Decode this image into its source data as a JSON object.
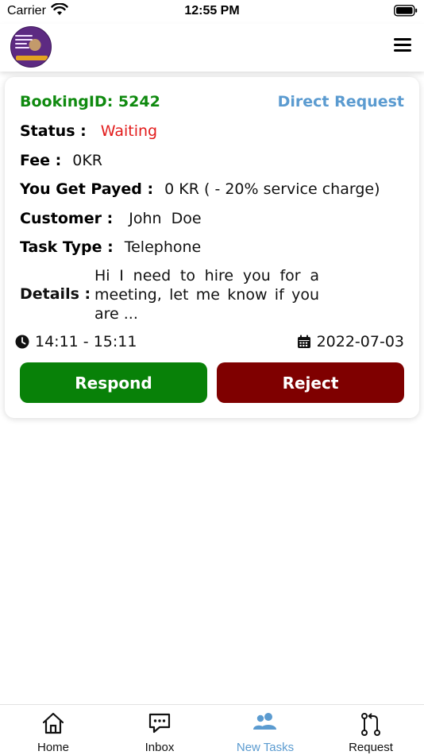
{
  "status_bar": {
    "carrier": "Carrier",
    "time": "12:55 PM"
  },
  "header": {
    "avatar": "profile-avatar",
    "menu_icon": "hamburger-menu-icon"
  },
  "booking": {
    "booking_id_label": "BookingID: 5242",
    "request_type": "Direct Request",
    "status_label": "Status :",
    "status_value": "Waiting",
    "fee_label": "Fee :",
    "fee_value": "0KR",
    "payout_label": "You Get Payed :",
    "payout_value": "0 KR ( - 20% service charge)",
    "customer_label": "Customer :",
    "customer_value": "John  Doe",
    "task_type_label": "Task Type :",
    "task_type_value": "Telephone",
    "details_label": "Details :",
    "details_value": "Hi I need to hire you for a meeting, let me know if you are ...",
    "time_range": "14:11 - 15:11",
    "date": "2022-07-03",
    "respond_label": "Respond",
    "reject_label": "Reject"
  },
  "colors": {
    "booking_id": "#0f8a0f",
    "direct_request": "#5b9bd0",
    "status_waiting": "#e21b1b",
    "respond_button": "#088108",
    "reject_button": "#7f0000",
    "tab_active": "#5b9bd0"
  },
  "tabs": [
    {
      "label": "Home",
      "icon": "home-icon",
      "active": false
    },
    {
      "label": "Inbox",
      "icon": "chat-icon",
      "active": false
    },
    {
      "label": "New Tasks",
      "icon": "users-icon",
      "active": true
    },
    {
      "label": "Request",
      "icon": "pull-request-icon",
      "active": false
    }
  ]
}
